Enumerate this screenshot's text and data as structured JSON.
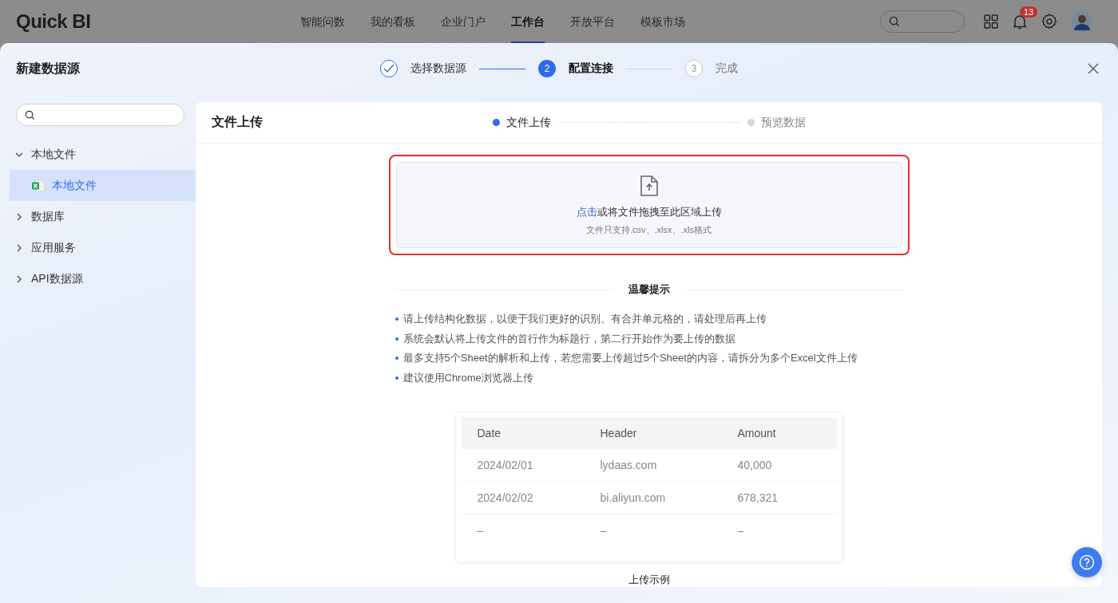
{
  "app": {
    "logo": "Quick BI",
    "nav": [
      {
        "label": "智能问数",
        "selected": false
      },
      {
        "label": "我的看板",
        "selected": false
      },
      {
        "label": "企业门户",
        "selected": false
      },
      {
        "label": "工作台",
        "selected": true
      },
      {
        "label": "开放平台",
        "selected": false
      },
      {
        "label": "模板市场",
        "selected": false
      }
    ],
    "notification_count": "13"
  },
  "modal": {
    "title": "新建数据源",
    "steps": [
      {
        "label": "选择数据源",
        "done": true,
        "selected": false
      },
      {
        "marker": "2",
        "label": "配置连接",
        "done": false,
        "selected": true
      },
      {
        "marker": "3",
        "label": "完成",
        "done": false,
        "selected": false
      }
    ]
  },
  "sidebar": {
    "items": [
      {
        "label": "本地文件",
        "expanded": true,
        "selected": false,
        "children": [
          {
            "label": "本地文件",
            "kind": "excel",
            "selected": true
          }
        ]
      },
      {
        "label": "数据库",
        "expanded": false,
        "selected": false
      },
      {
        "label": "应用服务",
        "expanded": false,
        "selected": false
      },
      {
        "label": "API数据源",
        "expanded": false,
        "selected": false
      }
    ]
  },
  "panel": {
    "title": "文件上传",
    "substeps": [
      {
        "label": "文件上传",
        "selected": true
      },
      {
        "label": "预览数据",
        "selected": false
      }
    ],
    "upload": {
      "highlighted": true,
      "link": "点击",
      "text": "或将文件拖拽至此区域上传",
      "hint": "文件只支持.csv、.xlsx、.xls格式"
    },
    "tips": {
      "title": "温馨提示",
      "items": [
        "请上传结构化数据，以便于我们更好的识别。有合并单元格的，请处理后再上传",
        "系统会默认将上传文件的首行作为标题行，第二行开始作为要上传的数据",
        "最多支持5个Sheet的解析和上传，若您需要上传超过5个Sheet的内容，请拆分为多个Excel文件上传",
        "建议使用Chrome浏览器上传"
      ]
    },
    "sample": {
      "columns": [
        "Date",
        "Header",
        "Amount"
      ],
      "rows": [
        [
          "2024/02/01",
          "lydaas.com",
          "40,000"
        ],
        [
          "2024/02/02",
          "bi.aliyun.com",
          "678,321"
        ],
        [
          "–",
          "–",
          "–"
        ]
      ],
      "caption": "上传示例"
    }
  }
}
